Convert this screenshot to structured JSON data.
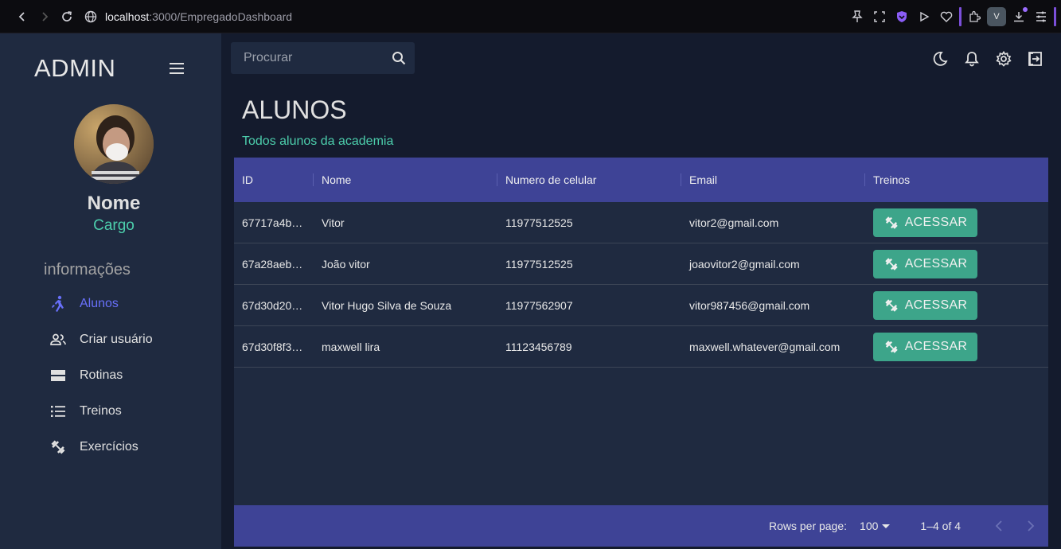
{
  "browser": {
    "url_host": "localhost",
    "url_path": ":3000/EmpregadoDashboard",
    "profile_letter": "V"
  },
  "sidebar": {
    "brand": "ADMIN",
    "profile": {
      "name": "Nome",
      "role": "Cargo"
    },
    "section_title": "informações",
    "items": [
      {
        "label": "Alunos",
        "icon": "directions-run-icon",
        "active": true
      },
      {
        "label": "Criar usuário",
        "icon": "people-icon",
        "active": false
      },
      {
        "label": "Rotinas",
        "icon": "view-stream-icon",
        "active": false
      },
      {
        "label": "Treinos",
        "icon": "list-icon",
        "active": false
      },
      {
        "label": "Exercícios",
        "icon": "fitness-center-icon",
        "active": false
      }
    ]
  },
  "topbar": {
    "search_placeholder": "Procurar",
    "icons": [
      "dark-mode-icon",
      "notifications-icon",
      "settings-icon",
      "logout-icon"
    ]
  },
  "page": {
    "title": "ALUNOS",
    "subtitle": "Todos alunos da academia"
  },
  "table": {
    "columns": [
      "ID",
      "Nome",
      "Numero de celular",
      "Email",
      "Treinos"
    ],
    "rows": [
      {
        "id": "67717a4b…",
        "name": "Vitor",
        "phone": "11977512525",
        "email": "vitor2@gmail.com",
        "action": "ACESSAR"
      },
      {
        "id": "67a28aeb…",
        "name": "João vitor",
        "phone": "11977512525",
        "email": "joaovitor2@gmail.com",
        "action": "ACESSAR"
      },
      {
        "id": "67d30d20…",
        "name": "Vitor Hugo Silva de Souza",
        "phone": "11977562907",
        "email": "vitor987456@gmail.com",
        "action": "ACESSAR"
      },
      {
        "id": "67d30f8f3…",
        "name": "maxwell lira",
        "phone": "11123456789",
        "email": "maxwell.whatever@gmail.com",
        "action": "ACESSAR"
      }
    ],
    "footer": {
      "rows_per_page_label": "Rows per page:",
      "rows_per_page_value": "100",
      "range": "1–4 of 4"
    }
  },
  "colors": {
    "accent_green": "#4cceac",
    "button_green": "#3da58a",
    "header_blue": "#3e4396",
    "active_purple": "#6870fa",
    "panel": "#1f2a40",
    "background": "#141b2d"
  }
}
